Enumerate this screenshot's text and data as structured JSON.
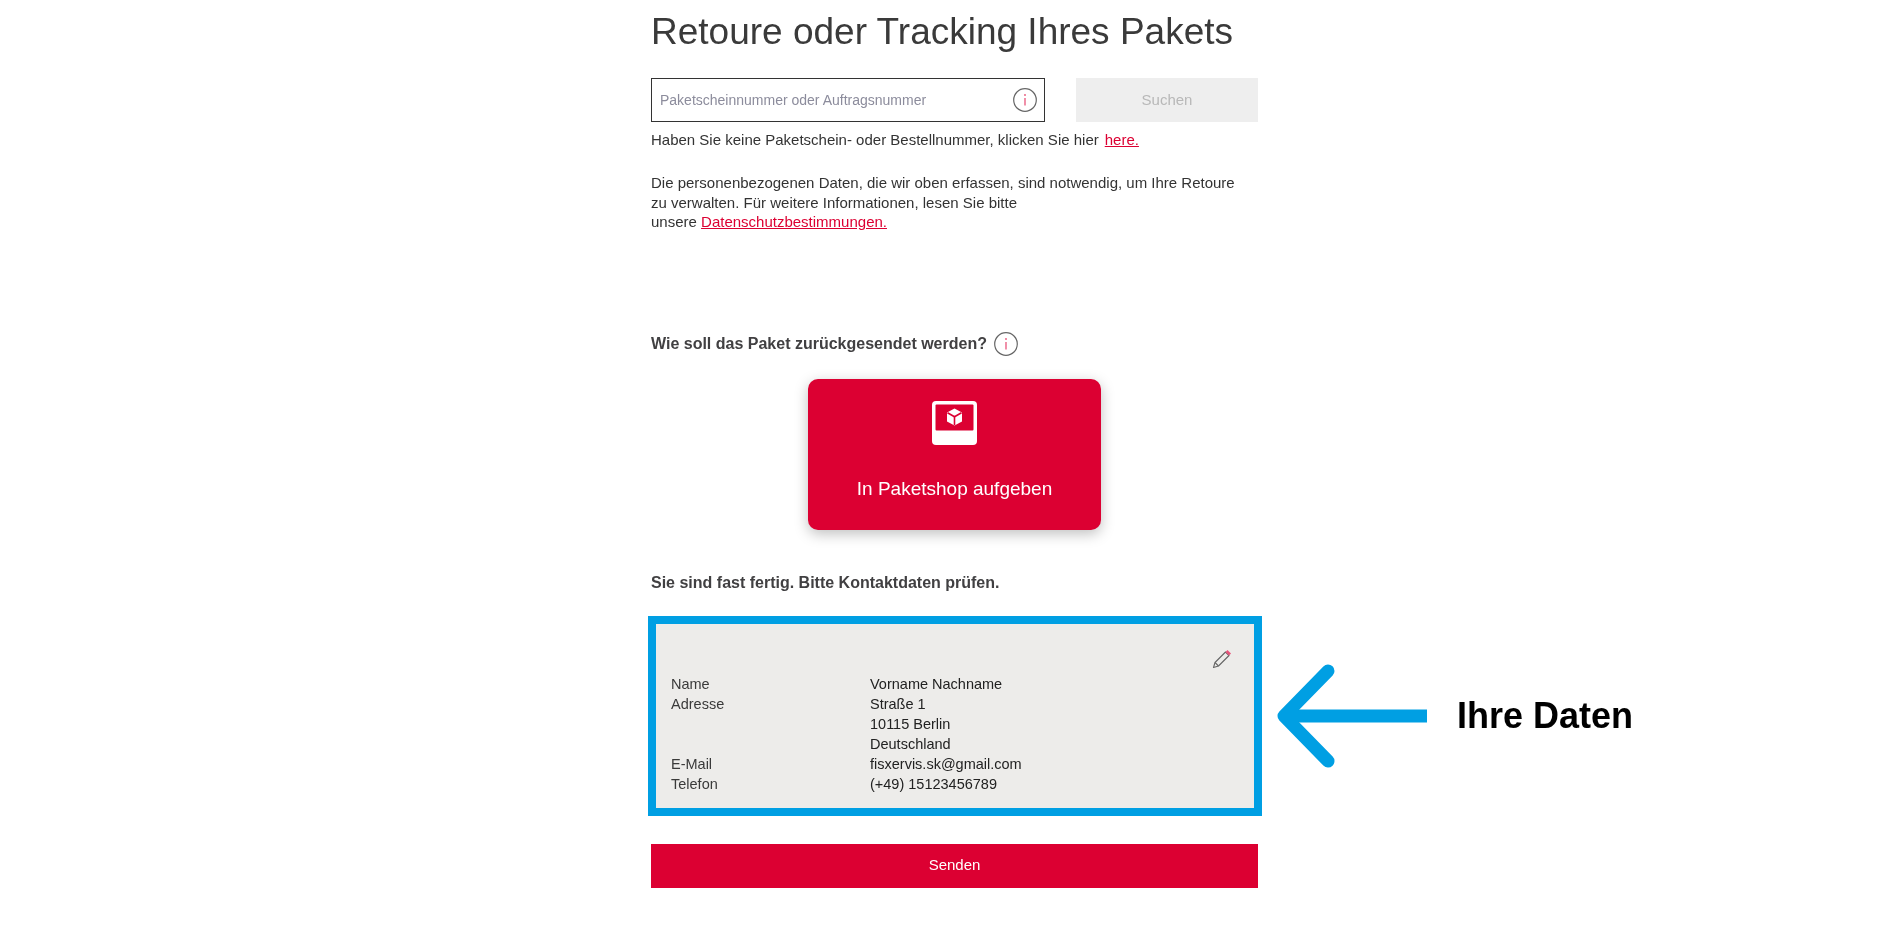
{
  "page": {
    "title": "Retoure oder Tracking Ihres Pakets"
  },
  "search": {
    "placeholder": "Paketscheinnummer oder Auftragsnummer",
    "button": {
      "label": "Suchen",
      "disabled": true
    }
  },
  "no_number_hint": {
    "text": "Haben Sie keine Paketschein- oder Bestellnummer, klicken Sie hier",
    "link": "here."
  },
  "privacy_note": {
    "text": "Die personenbezogenen Daten, die wir oben erfassen, sind notwendig, um Ihre Retoure zu verwalten. Für weitere Informationen, lesen Sie bitte",
    "link_prefix": "unsere",
    "link": "Datenschutzbestimmungen."
  },
  "return_method": {
    "question": "Wie soll das Paket zurückgesendet werden?",
    "options": [
      {
        "label": "In Paketshop aufgeben",
        "selected": true
      }
    ]
  },
  "contact": {
    "heading": "Sie sind fast fertig. Bitte Kontaktdaten prüfen.",
    "rows": [
      {
        "label": "Name",
        "values": [
          "Vorname Nachname"
        ]
      },
      {
        "label": "Adresse",
        "values": [
          "Straße 1",
          "10115 Berlin",
          "Deutschland"
        ]
      },
      {
        "label": "E-Mail",
        "values": [
          "fisxervis.sk@gmail.com"
        ]
      },
      {
        "label": "Telefon",
        "values": [
          "(+49) 15123456789"
        ]
      }
    ]
  },
  "annotation": {
    "label": "Ihre Daten"
  },
  "submit_button": {
    "label": "Senden"
  }
}
